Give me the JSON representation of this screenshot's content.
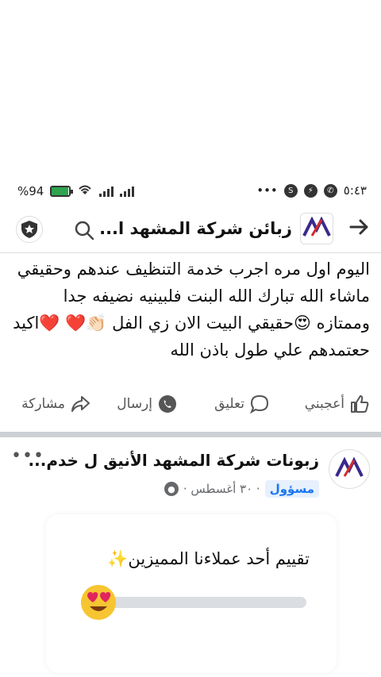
{
  "status_bar": {
    "time": "٥:٤٣",
    "battery_text": "%94",
    "battery_level": 0.94
  },
  "header": {
    "title": "زبائن شركة المشهد ا...",
    "icons": [
      "back-arrow-icon",
      "search-icon",
      "shield-star-icon"
    ]
  },
  "post": {
    "text": "اليوم اول مره اجرب خدمة التنظيف عندهم وحقيقي ماشاء الله تبارك الله البنت فلبينيه نضيفه جدا وممتازه 😍حقيقي البيت الان زي الفل 👏🏻❤️ ❤️اكيد حعتمدهم علي طول باذن الله"
  },
  "actions": {
    "like": "أعجبني",
    "comment": "تعليق",
    "send": "إرسال",
    "share": "مشاركة"
  },
  "post2": {
    "title": "زبونات شركة المشهد الأنيق ل خدم...",
    "more": "•••",
    "badge": "مسؤول",
    "meta": "· ٣٠ أغسطس ·"
  },
  "poll": {
    "question": "تقييم أحد عملاءنا المميزين✨",
    "progress": 0.15
  },
  "colors": {
    "brand_blue": "#1877f2",
    "logo_purple": "#3a2a8c",
    "logo_red": "#d62a2a"
  }
}
